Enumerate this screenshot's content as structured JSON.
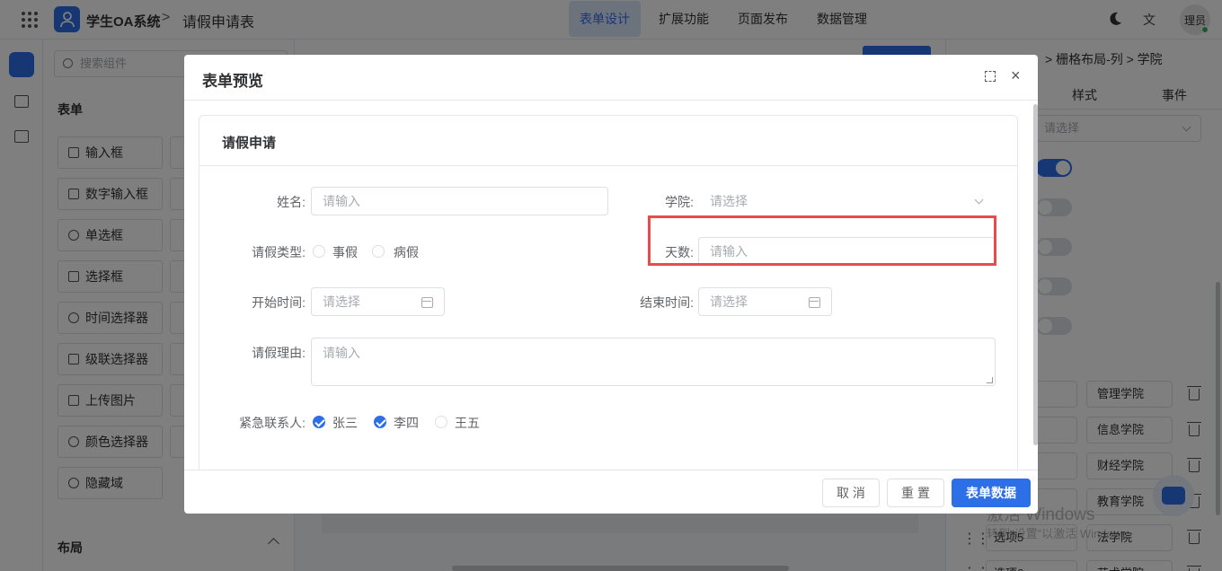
{
  "topbar": {
    "app_title": "学生OA系统",
    "separator": ">",
    "page_title": "请假申请表",
    "tabs": [
      "表单设计",
      "扩展功能",
      "页面发布",
      "数据管理"
    ],
    "active_tab": "表单设计",
    "lang_glyph": "文",
    "avatar_text": "理员"
  },
  "components": {
    "search_placeholder": "搜索组件",
    "section_form": "表单",
    "items": [
      "输入框",
      "数字输入框",
      "单选框",
      "选择框",
      "时间选择器",
      "级联选择器",
      "上传图片",
      "颜色选择器",
      "隐藏域"
    ],
    "section_layout": "布局"
  },
  "right_panel": {
    "breadcrumb": "> 栅格布局-列 > 学院",
    "tabs": [
      "样式",
      "事件"
    ],
    "select_placeholder": "请选择",
    "options": [
      {
        "value": "管理学院"
      },
      {
        "value": "信息学院"
      },
      {
        "value": "财经学院"
      },
      {
        "value": "教育学院"
      },
      {
        "label": "选项5",
        "value": "法学院"
      },
      {
        "label": "选项6",
        "value": "艺术学院"
      }
    ],
    "watermark_1": "激活 Windows",
    "watermark_2": "转到\"设置\"以激活 Windows。"
  },
  "dialog": {
    "title": "表单预览",
    "close_glyph": "×",
    "card_title": "请假申请",
    "fields": {
      "name_label": "姓名:",
      "name_placeholder": "请输入",
      "college_label": "学院:",
      "college_placeholder": "请选择",
      "leave_type_label": "请假类型:",
      "leave_types": [
        "事假",
        "病假"
      ],
      "days_label": "天数:",
      "days_placeholder": "请输入",
      "start_label": "开始时间:",
      "start_placeholder": "请选择",
      "end_label": "结束时间:",
      "end_placeholder": "请选择",
      "reason_label": "请假理由:",
      "reason_placeholder": "请输入",
      "contact_label": "紧急联系人:",
      "contacts": [
        {
          "name": "张三",
          "checked": true
        },
        {
          "name": "李四",
          "checked": true
        },
        {
          "name": "王五",
          "checked": false
        }
      ]
    },
    "buttons": {
      "cancel": "取 消",
      "reset": "重 置",
      "submit": "表单数据"
    }
  },
  "colors": {
    "primary": "#2c6fe6",
    "highlight_border": "#e84c4c"
  }
}
